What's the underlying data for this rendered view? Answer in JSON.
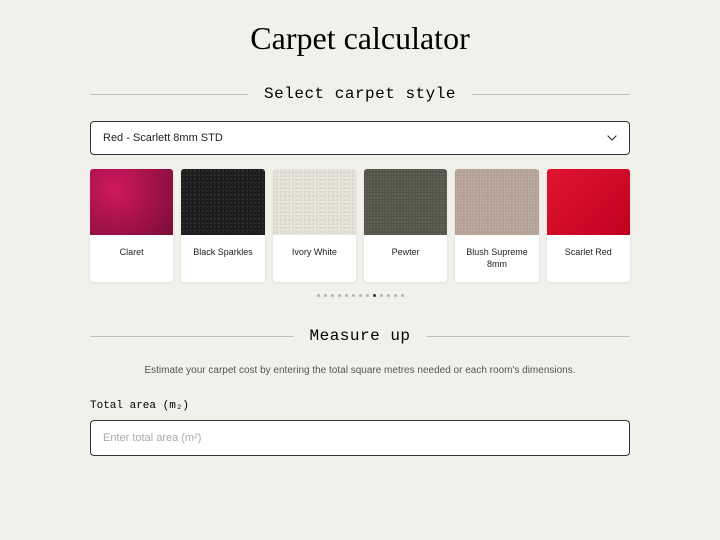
{
  "title": "Carpet calculator",
  "sections": {
    "select_style": {
      "heading": "Select carpet style",
      "dropdown_value": "Red - Scarlett 8mm STD"
    },
    "measure_up": {
      "heading": "Measure up",
      "subtitle": "Estimate your carpet cost by entering the total square metres needed or each room's dimensions.",
      "total_area_label": "Total area (m₂)",
      "total_area_placeholder": "Enter total area (m²)"
    }
  },
  "swatches": [
    {
      "label": "Claret",
      "class": "sw-claret"
    },
    {
      "label": "Black Sparkles",
      "class": "sw-black"
    },
    {
      "label": "Ivory White",
      "class": "sw-ivory"
    },
    {
      "label": "Pewter",
      "class": "sw-pewter"
    },
    {
      "label": "Blush Supreme 8mm",
      "class": "sw-blush"
    },
    {
      "label": "Scarlet Red",
      "class": "sw-scarlet"
    }
  ],
  "carousel": {
    "total_dots": 13,
    "active_index": 8
  }
}
